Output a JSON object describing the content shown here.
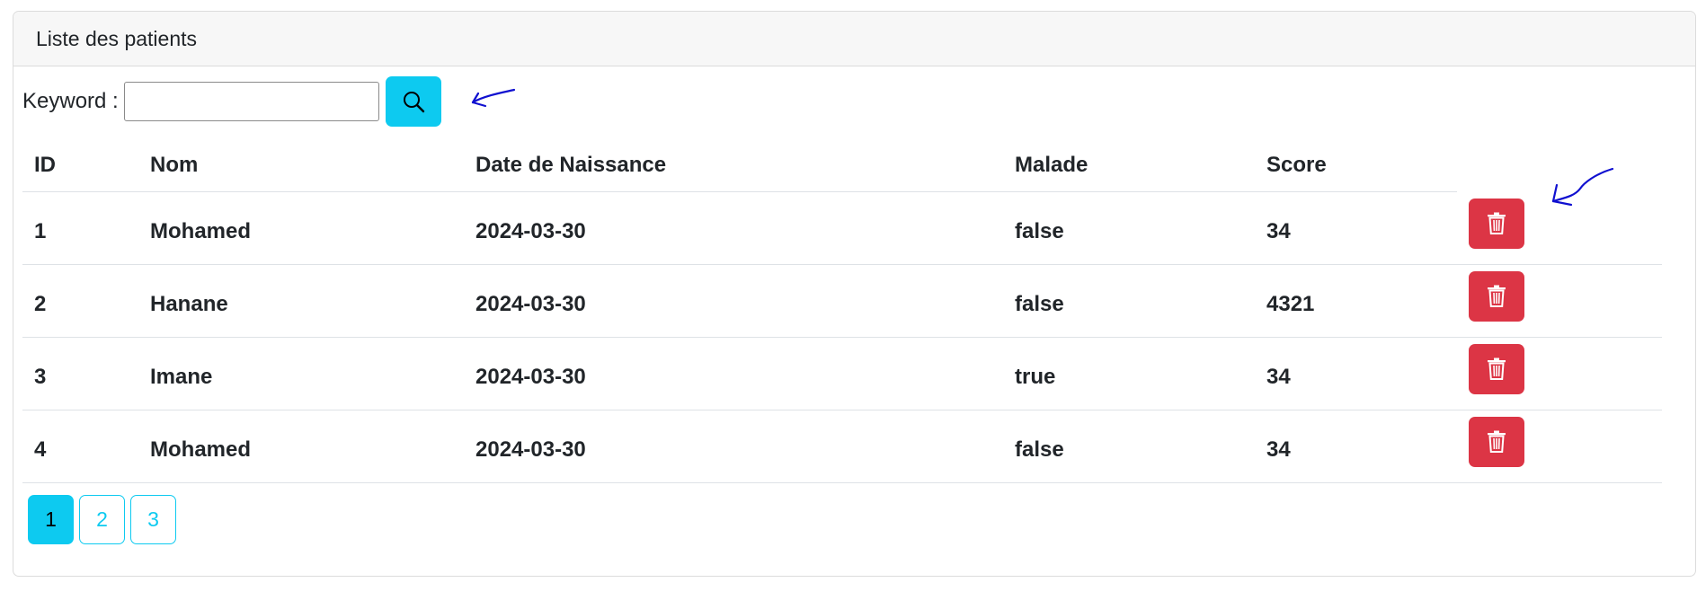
{
  "card": {
    "title": "Liste des patients"
  },
  "search": {
    "label": "Keyword :",
    "value": "",
    "placeholder": "",
    "button_icon": "search-icon"
  },
  "table": {
    "headers": [
      "ID",
      "Nom",
      "Date de Naissance",
      "Malade",
      "Score"
    ],
    "rows": [
      {
        "id": "1",
        "nom": "Mohamed",
        "date": "2024-03-30",
        "malade": "false",
        "score": "34",
        "action_icon": "trash-icon"
      },
      {
        "id": "2",
        "nom": "Hanane",
        "date": "2024-03-30",
        "malade": "false",
        "score": "4321",
        "action_icon": "trash-icon"
      },
      {
        "id": "3",
        "nom": "Imane",
        "date": "2024-03-30",
        "malade": "true",
        "score": "34",
        "action_icon": "trash-icon"
      },
      {
        "id": "4",
        "nom": "Mohamed",
        "date": "2024-03-30",
        "malade": "false",
        "score": "34",
        "action_icon": "trash-icon"
      }
    ]
  },
  "pagination": {
    "pages": [
      "1",
      "2",
      "3"
    ],
    "current": "1"
  },
  "colors": {
    "info": "#0dcaf0",
    "danger": "#dc3545",
    "annotation": "#1010d0"
  }
}
